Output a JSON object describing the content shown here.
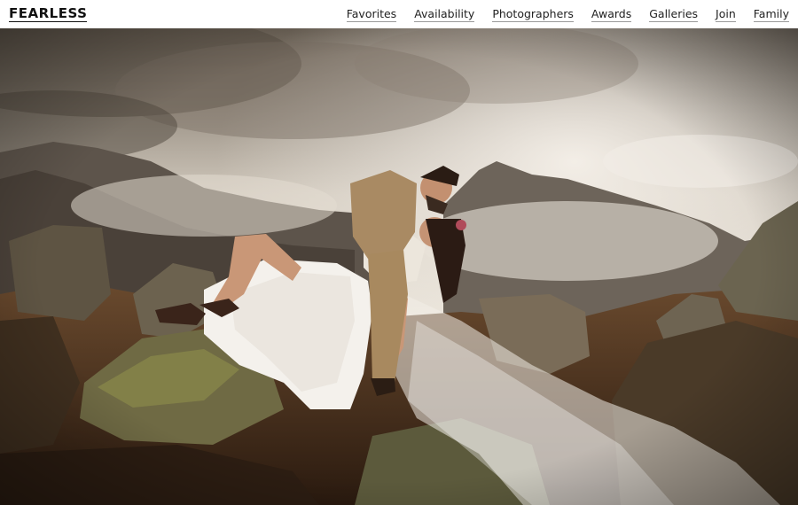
{
  "brand": {
    "logo_text": "FEARLESS"
  },
  "nav": {
    "items": [
      {
        "label": "Favorites"
      },
      {
        "label": "Availability"
      },
      {
        "label": "Photographers"
      },
      {
        "label": "Awards"
      },
      {
        "label": "Galleries"
      },
      {
        "label": "Join"
      },
      {
        "label": "Family"
      }
    ]
  },
  "colors": {
    "background": "#ffffff",
    "text": "#111111",
    "link_underline": "#9a9a9a"
  }
}
